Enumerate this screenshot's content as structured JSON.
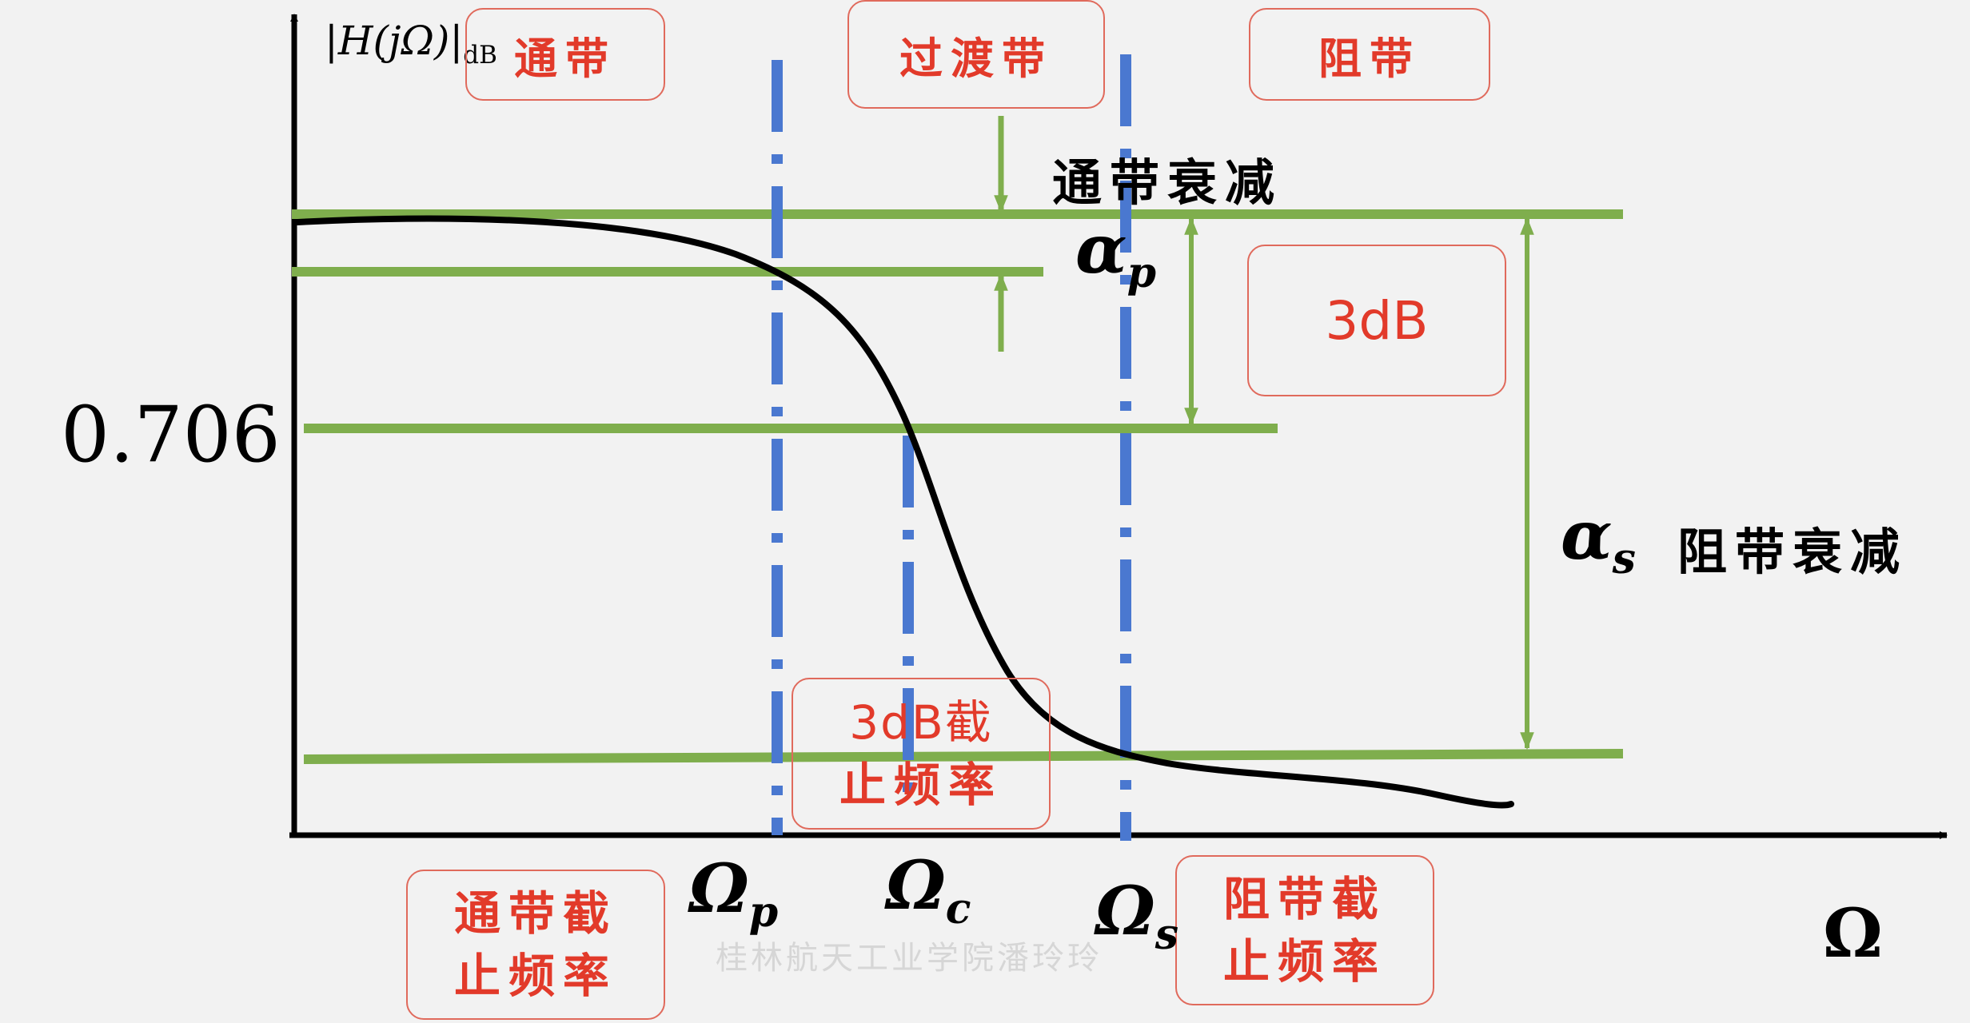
{
  "y_axis_label": "|H(jΩ)|",
  "y_axis_unit": "dB",
  "x_axis_label": "Ω",
  "y_tick_value": "0.706",
  "regions": {
    "passband": "通带",
    "transition": "过渡带",
    "stopband": "阻带"
  },
  "annotations": {
    "passband_attenuation": "通带衰减",
    "alpha_p_symbol": "α",
    "alpha_p_sub": "p",
    "three_db": "3dB",
    "alpha_s_symbol": "α",
    "alpha_s_sub": "s",
    "stopband_attenuation": "阻带衰减"
  },
  "frequency_markers": {
    "omega_p_symbol": "Ω",
    "omega_p_sub": "p",
    "omega_c_symbol": "Ω",
    "omega_c_sub": "c",
    "omega_s_symbol": "Ω",
    "omega_s_sub": "s"
  },
  "cutoff_boxes": {
    "passband_cutoff_line1": "通带截",
    "passband_cutoff_line2": "止频率",
    "three_db_cutoff_line1": "3dB截",
    "three_db_cutoff_line2": "止频率",
    "stopband_cutoff_line1": "阻带截",
    "stopband_cutoff_line2": "止频率"
  },
  "watermark": "桂林航天工业学院潘玲玲",
  "colors": {
    "axis": "#000000",
    "curve": "#000000",
    "guide_lines": "#7fae4d",
    "cutoff_lines": "#4a78d0",
    "label_text": "#e23a2a",
    "label_border": "#e06a5c"
  }
}
